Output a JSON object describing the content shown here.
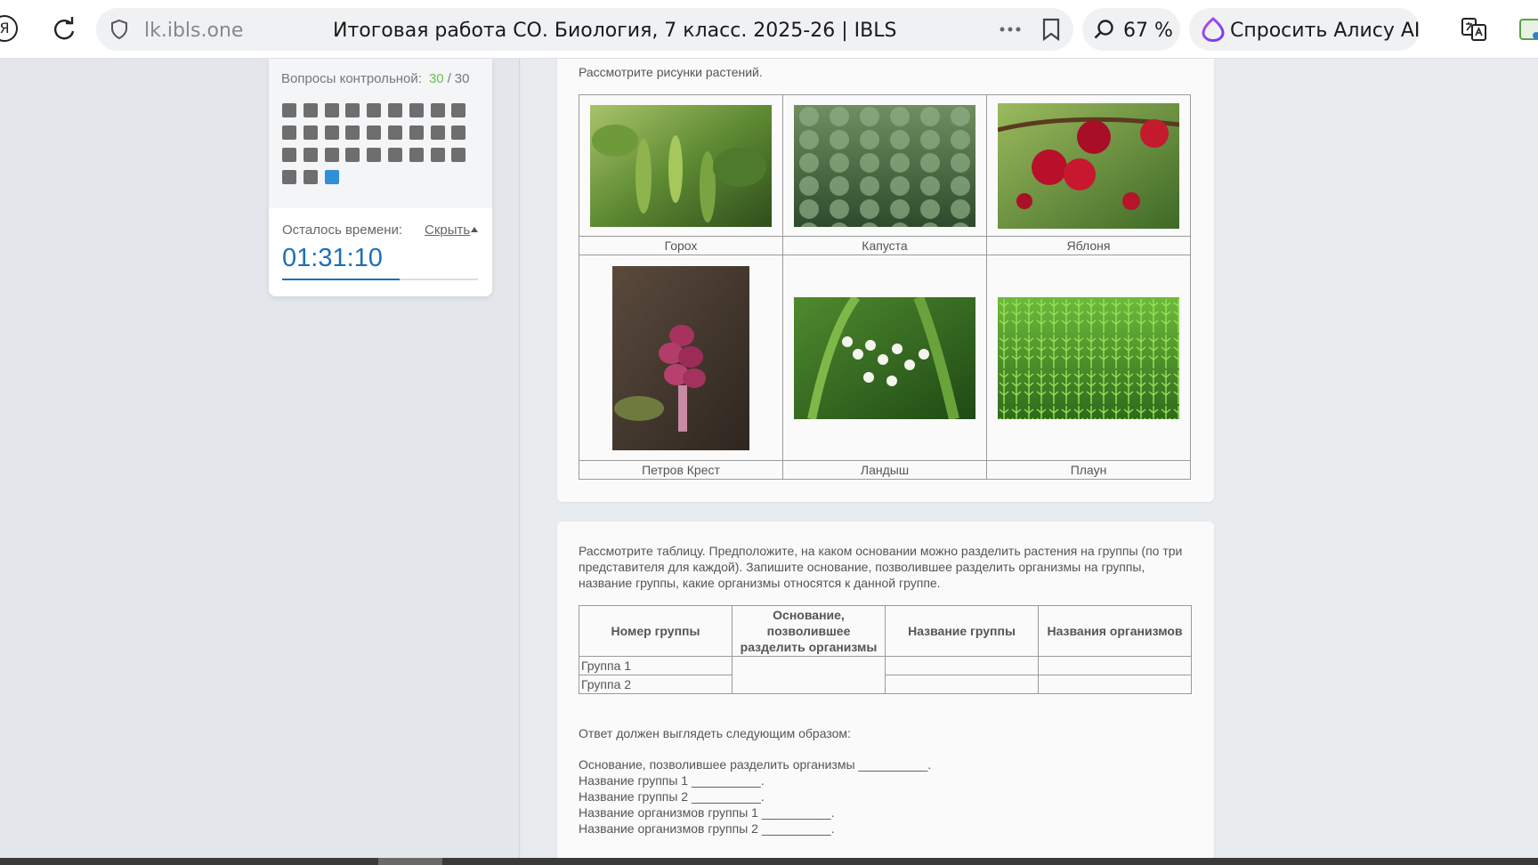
{
  "browser": {
    "brand_glyph": "Я",
    "domain": "lk.ibls.one",
    "tab_title": "Итоговая работа СО. Биология, 7 класс. 2025-26 | IBLS",
    "zoom": "67 %",
    "alice_label": "Спросить Алису AI"
  },
  "sidebar": {
    "questions_label": "Вопросы контрольной:",
    "questions_current": "30",
    "questions_separator": "/",
    "questions_total": "30",
    "question_count": 30,
    "active_question": 30,
    "timer_label": "Осталось времени:",
    "hide_label": "Скрыть",
    "time_left": "01:31:10",
    "time_progress": 0.6
  },
  "card1": {
    "intro": "Рассмотрите рисунки растений.",
    "plants": [
      {
        "name": "Горох"
      },
      {
        "name": "Капуста"
      },
      {
        "name": "Яблоня"
      },
      {
        "name": "Петров Крест"
      },
      {
        "name": "Ландыш"
      },
      {
        "name": "Плаун"
      }
    ]
  },
  "card2": {
    "task": "Рассмотрите таблицу. Предположите, на каком основании можно разделить растения на группы (по три представителя для каждой). Запишите основание, позволившее разделить организмы на группы, название группы, какие организмы относятся к данной группе.",
    "table": {
      "headers": [
        "Номер группы",
        "Основание, позволившее разделить организмы",
        "Название группы",
        "Названия организмов"
      ],
      "rows": [
        "Группа 1",
        "Группа 2"
      ]
    },
    "answer_intro": "Ответ должен выглядеть следующим образом:",
    "answer_lines": [
      "Основание, позволившее разделить организмы __________.",
      "Название группы 1 __________.",
      "Название группы 2 __________.",
      "Название организмов группы 1 __________.",
      "Название организмов группы 2 __________."
    ]
  },
  "colors": {
    "accent": "#2f8fd8",
    "timer": "#1f6fb5",
    "done_count": "#6abf4b"
  }
}
